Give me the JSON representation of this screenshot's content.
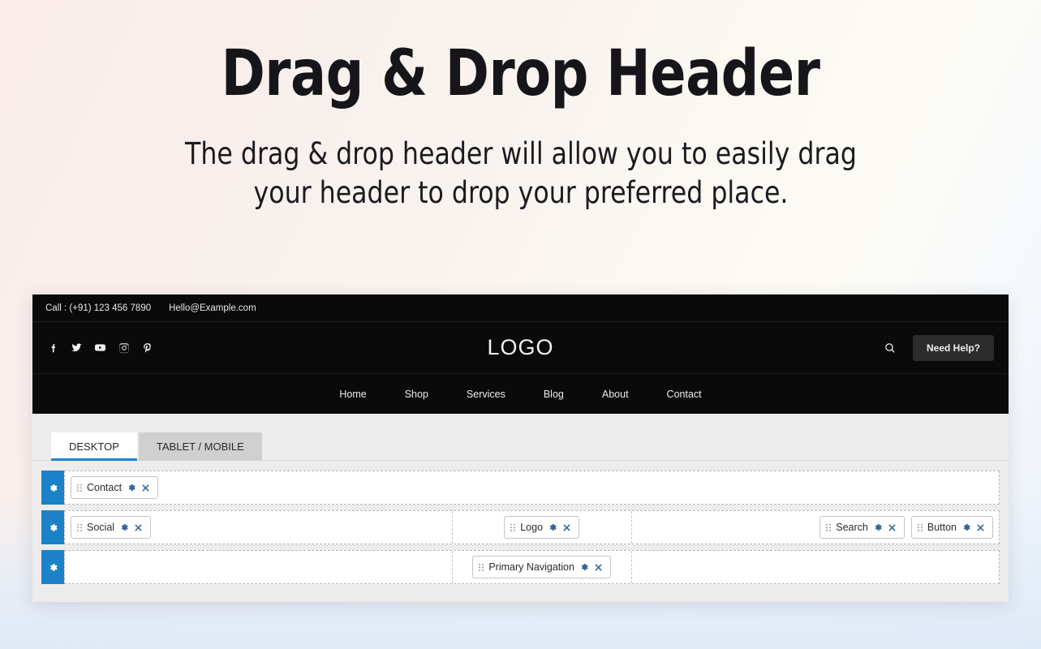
{
  "hero": {
    "title": "Drag & Drop Header",
    "subtitle": "The drag & drop header will allow you to easily drag your header to drop your preferred place."
  },
  "colors": {
    "background_left": "#f9ecea",
    "background_right": "#e9f0f9",
    "header_bg": "#0a0a0a",
    "accent_blue": "#1b82c8",
    "tab_active_underline": "#1b86d0",
    "chip_icon_blue": "#35649b",
    "button_bg": "#2c2c2c"
  },
  "header_preview": {
    "topbar": {
      "phone": "Call : (+91) 123 456 7890",
      "email": "Hello@Example.com"
    },
    "socials": [
      {
        "name": "facebook-icon"
      },
      {
        "name": "twitter-icon"
      },
      {
        "name": "youtube-icon"
      },
      {
        "name": "instagram-icon"
      },
      {
        "name": "pinterest-icon"
      }
    ],
    "logo": "LOGO",
    "search_icon": "search-icon",
    "cta_label": "Need Help?",
    "nav": [
      {
        "label": "Home"
      },
      {
        "label": "Shop"
      },
      {
        "label": "Services"
      },
      {
        "label": "Blog"
      },
      {
        "label": "About"
      },
      {
        "label": "Contact"
      }
    ]
  },
  "builder": {
    "tabs": [
      {
        "label": "DESKTOP",
        "active": true
      },
      {
        "label": "TABLET / MOBILE",
        "active": false
      }
    ],
    "rows": [
      {
        "handle_icon": "gear-icon",
        "columns": [
          {
            "align": "left",
            "widgets": [
              {
                "label": "Contact"
              }
            ]
          }
        ]
      },
      {
        "handle_icon": "gear-icon",
        "columns": [
          {
            "align": "left",
            "widgets": [
              {
                "label": "Social"
              }
            ]
          },
          {
            "align": "center",
            "widgets": [
              {
                "label": "Logo"
              }
            ]
          },
          {
            "align": "right",
            "widgets": [
              {
                "label": "Search"
              },
              {
                "label": "Button"
              }
            ]
          }
        ]
      },
      {
        "handle_icon": "gear-icon",
        "columns": [
          {
            "align": "left",
            "widgets": []
          },
          {
            "align": "center",
            "widgets": [
              {
                "label": "Primary Navigation"
              }
            ]
          },
          {
            "align": "right",
            "widgets": []
          }
        ]
      }
    ],
    "widget_icons": {
      "drag": "drag-handle-icon",
      "settings": "gear-icon",
      "remove": "close-icon"
    }
  }
}
